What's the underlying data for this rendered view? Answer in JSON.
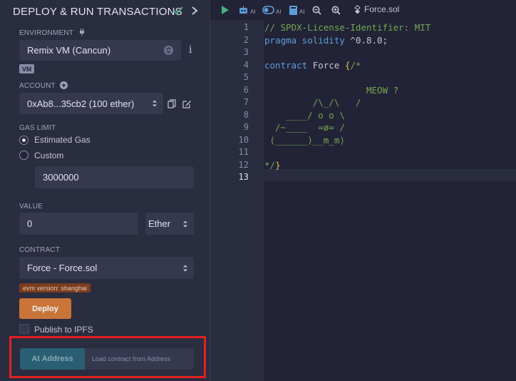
{
  "panel": {
    "title": "DEPLOY & RUN TRANSACTIONS",
    "environment_label": "ENVIRONMENT",
    "environment_value": "Remix VM (Cancun)",
    "vm_badge": "VM",
    "account_label": "ACCOUNT",
    "account_value": "0xAb8...35cb2 (100 ether)",
    "gas_limit_label": "GAS LIMIT",
    "gas_estimated": "Estimated Gas",
    "gas_custom": "Custom",
    "gas_value": "3000000",
    "value_label": "VALUE",
    "value_amount": "0",
    "value_unit": "Ether",
    "contract_label": "CONTRACT",
    "contract_value": "Force - Force.sol",
    "evm_badge": "evm version: shanghai",
    "deploy_label": "Deploy",
    "publish_label": "Publish to IPFS",
    "at_address_label": "At Address",
    "load_placeholder": "Load contract from Address"
  },
  "toolbar": {
    "ai1": "AI",
    "ai2": "AI",
    "ai3": "AI",
    "file_name": "Force.sol"
  },
  "editor": {
    "line_numbers": [
      "1",
      "2",
      "3",
      "4",
      "5",
      "6",
      "7",
      "8",
      "9",
      "10",
      "11",
      "12",
      "13"
    ],
    "lines": [
      "// SPDX-License-Identifier: MIT",
      "pragma solidity ^0.8.0;",
      "",
      "contract Force {/*",
      "",
      "                   MEOW ?",
      "         /\\_/\\   /",
      "    ____/ o o \\",
      "  /~____  =ø= /",
      " (______)__m_m)",
      "",
      "*/}",
      ""
    ]
  },
  "colors": {
    "deploy": "#c97539",
    "at_address": "#2a5f73",
    "highlight_box": "#e0201f",
    "comment": "#74a851",
    "keyword": "#5c9fd6"
  }
}
